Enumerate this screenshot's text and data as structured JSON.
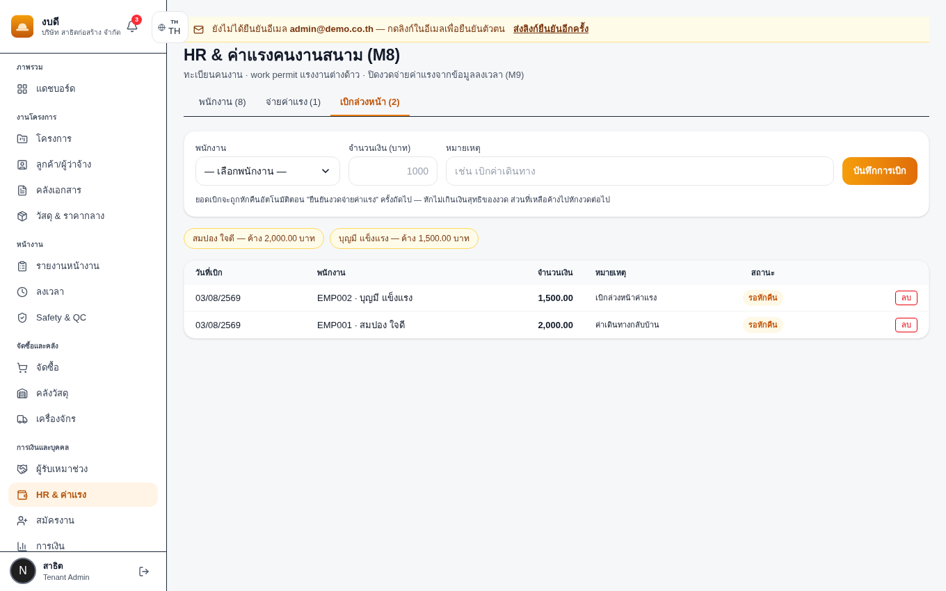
{
  "app": {
    "name": "งบดี",
    "company": "บริษัท สาธิตก่อสร้าง จำกัด"
  },
  "notifications": {
    "count": "3"
  },
  "language": {
    "small": "TH",
    "code": "TH"
  },
  "sidebar": {
    "sections": [
      {
        "title": "ภาพรวม",
        "items": [
          {
            "label": "แดชบอร์ด",
            "selected": false
          }
        ]
      },
      {
        "title": "งานโครงการ",
        "items": [
          {
            "label": "โครงการ",
            "selected": false
          },
          {
            "label": "ลูกค้า/ผู้ว่าจ้าง",
            "selected": false
          },
          {
            "label": "คลังเอกสาร",
            "selected": false
          },
          {
            "label": "วัสดุ & ราคากลาง",
            "selected": false
          }
        ]
      },
      {
        "title": "หน้างาน",
        "items": [
          {
            "label": "รายงานหน้างาน",
            "selected": false
          },
          {
            "label": "ลงเวลา",
            "selected": false
          },
          {
            "label": "Safety & QC",
            "selected": false
          }
        ]
      },
      {
        "title": "จัดซื้อและคลัง",
        "items": [
          {
            "label": "จัดซื้อ",
            "selected": false
          },
          {
            "label": "คลังวัสดุ",
            "selected": false
          },
          {
            "label": "เครื่องจักร",
            "selected": false
          }
        ]
      },
      {
        "title": "การเงินและบุคคล",
        "items": [
          {
            "label": "ผู้รับเหมาช่วง",
            "selected": false
          },
          {
            "label": "HR & ค่าแรง",
            "selected": true
          },
          {
            "label": "สมัครงาน",
            "selected": false
          },
          {
            "label": "การเงิน",
            "selected": false
          }
        ]
      }
    ]
  },
  "user": {
    "name": "สาธิต",
    "role": "Tenant Admin"
  },
  "dev_badge": "N",
  "banner": {
    "text": "ยังไม่ได้ยืนยันอีเมล **admin@demo.co.th** — กดลิงก์ในอีเมลเพื่อยืนยันตัวตน",
    "link": "ส่งลิงก์ยืนยันอีกครั้ง"
  },
  "page": {
    "title": "HR & ค่าแรงคนงานสนาม (M8)",
    "subtitle": "ทะเบียนคนงาน · work permit แรงงานต่างด้าว · ปิดงวดจ่ายค่าแรงจากข้อมูลลงเวลา (M9)"
  },
  "tabs": [
    {
      "label": "พนักงาน (8)",
      "selected": false
    },
    {
      "label": "จ่ายค่าแรง (1)",
      "selected": false
    },
    {
      "label": "เบิกล่วงหน้า (2)",
      "selected": true
    }
  ],
  "form": {
    "fields": [
      {
        "kind": "select",
        "label": "พนักงาน",
        "value": "— เลือกพนักงาน —"
      },
      {
        "kind": "number",
        "label": "จำนวนเงิน (บาท)",
        "placeholder": "1000"
      },
      {
        "kind": "text",
        "label": "หมายเหตุ",
        "placeholder": "เช่น เบิกค่าเดินทาง"
      }
    ],
    "button": "บันทึกการเบิก",
    "note": "ยอดเบิกจะถูกหักคืนอัตโนมัติตอน \"ยืนยันงวดจ่ายค่าแรง\" ครั้งถัดไป — หักไม่เกินเงินสุทธิของงวด ส่วนที่เหลือค้างไปหักงวดต่อไป"
  },
  "balances": [
    "สมปอง ใจดี — ค้าง 2,000.00 บาท",
    "บุญมี แข็งแรง — ค้าง 1,500.00 บาท"
  ],
  "table": {
    "columns": [
      "วันที่เบิก",
      "พนักงาน",
      "จำนวนเงิน",
      "หมายเหตุ",
      "สถานะ"
    ],
    "rows": [
      {
        "date": "03/08/2569",
        "employee": "EMP002 · บุญมี แข็งแรง",
        "amount": "1,500.00",
        "note": "เบิกล่วงหน้าค่าแรง",
        "status": "รอหักคืน",
        "action": "ลบ"
      },
      {
        "date": "03/08/2569",
        "employee": "EMP001 · สมปอง ใจดี",
        "amount": "2,000.00",
        "note": "ค่าเดินทางกลับบ้าน",
        "status": "รอหักคืน",
        "action": "ลบ"
      }
    ]
  }
}
